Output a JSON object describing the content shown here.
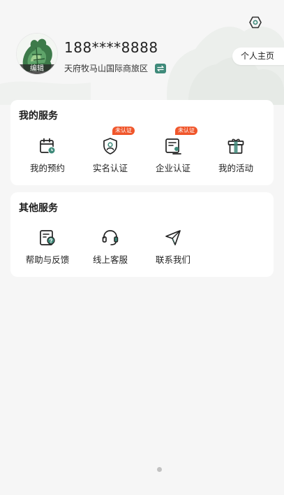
{
  "profile": {
    "phone": "188****8888",
    "location": "天府牧马山国际商旅区",
    "avatar_edit_label": "编辑",
    "homepage_label": "个人主页"
  },
  "my_services": {
    "title": "我的服务",
    "items": [
      {
        "label": "我的预约",
        "icon": "calendar-clock-icon"
      },
      {
        "label": "实名认证",
        "icon": "shield-user-icon",
        "badge": "未认证"
      },
      {
        "label": "企业认证",
        "icon": "enterprise-certificate-icon",
        "badge": "未认证"
      },
      {
        "label": "我的活动",
        "icon": "gift-icon"
      }
    ]
  },
  "other_services": {
    "title": "其他服务",
    "items": [
      {
        "label": "帮助与反馈",
        "icon": "help-feedback-icon"
      },
      {
        "label": "线上客服",
        "icon": "headset-icon"
      },
      {
        "label": "联系我们",
        "icon": "paper-plane-icon"
      }
    ]
  },
  "colors": {
    "accent": "#3f8a7a",
    "badge": "#f0562b",
    "background": "#f6f6f6"
  }
}
